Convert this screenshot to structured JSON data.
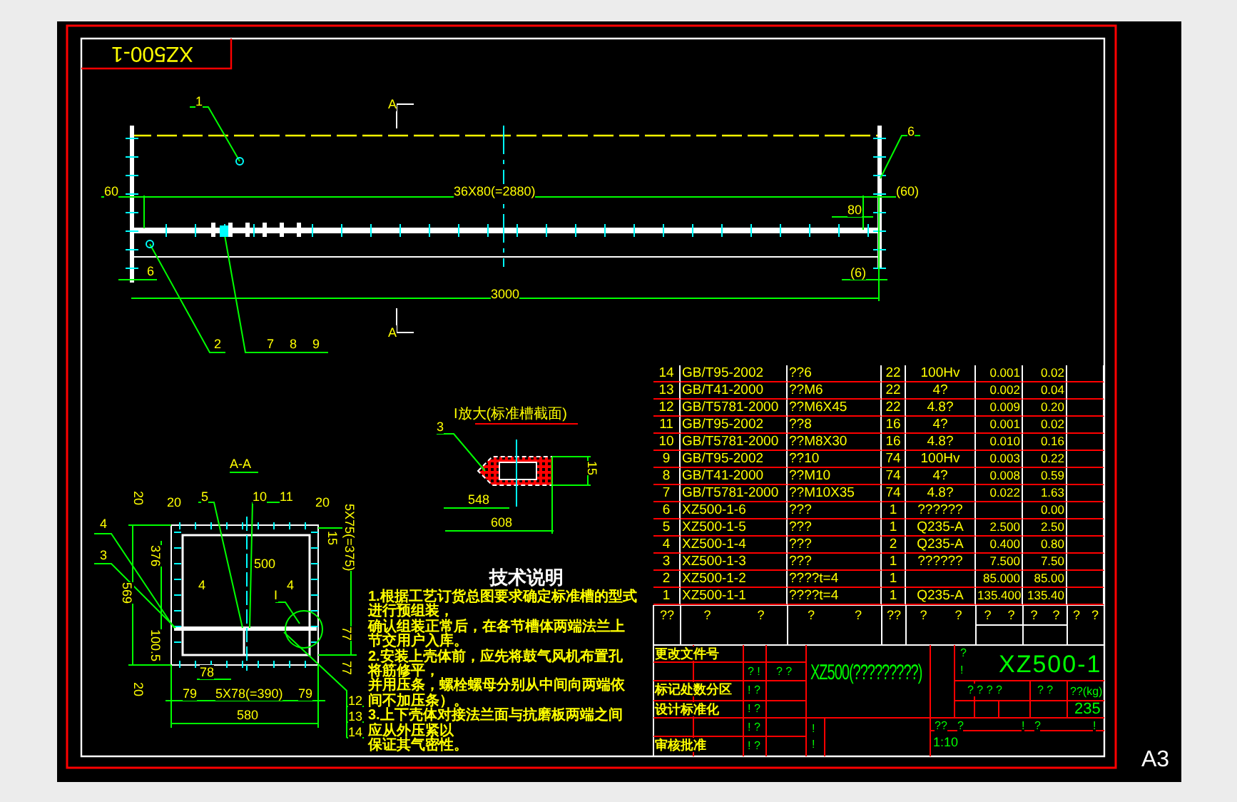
{
  "drawing_tab": "XZ500-1",
  "sheet_size": "A3",
  "main_view": {
    "labels": [
      "A",
      "1",
      "6",
      "60",
      "36X80(=2880)",
      "(60)",
      "80",
      "6",
      "(6)",
      "3000",
      "A",
      "2",
      "7",
      "8",
      "9"
    ]
  },
  "section_view": {
    "title": "A-A",
    "labels": [
      "20",
      "20",
      "5",
      "10",
      "11",
      "20",
      "4",
      "3",
      "376",
      "15",
      "5X75(=375)",
      "500",
      "569",
      "4",
      "4",
      "I",
      "77",
      "100.5",
      "77",
      "78",
      "20",
      "79",
      "5X78(=390)",
      "79",
      "580",
      "12",
      "13",
      "14"
    ]
  },
  "detail_view": {
    "title": "I放大(标准槽截面)",
    "labels": [
      "3",
      "15",
      "548",
      "608"
    ]
  },
  "notes": {
    "title": "技术说明",
    "lines": [
      "1.根据工艺订货总图要求确定标准槽的型式",
      "进行预组装，",
      "确认组装正常后，在各节槽体两端法兰上",
      "节交用户入库。",
      "2.安装上壳体前，应先将鼓气风机布置孔",
      "将筋修平，",
      "并用压条，螺栓螺母分别从中间向两端依",
      "间不加压条）。",
      "3.上下壳体对接法兰面与抗磨板两端之间",
      "应从外压紧以",
      "保证其气密性。"
    ]
  },
  "parts_list": {
    "rows": [
      {
        "no": "14",
        "code": "GB/T95-2002",
        "name": "??6",
        "qty": "22",
        "material": "100Hv",
        "unit_weight": "0.001",
        "total_weight": "0.02"
      },
      {
        "no": "13",
        "code": "GB/T41-2000",
        "name": "??M6",
        "qty": "22",
        "material": "4?",
        "unit_weight": "0.002",
        "total_weight": "0.04"
      },
      {
        "no": "12",
        "code": "GB/T5781-2000",
        "name": "??M6X45",
        "qty": "22",
        "material": "4.8?",
        "unit_weight": "0.009",
        "total_weight": "0.20"
      },
      {
        "no": "11",
        "code": "GB/T95-2002",
        "name": "??8",
        "qty": "16",
        "material": "4?",
        "unit_weight": "0.001",
        "total_weight": "0.02"
      },
      {
        "no": "10",
        "code": "GB/T5781-2000",
        "name": "??M8X30",
        "qty": "16",
        "material": "4.8?",
        "unit_weight": "0.010",
        "total_weight": "0.16"
      },
      {
        "no": "9",
        "code": "GB/T95-2002",
        "name": "??10",
        "qty": "74",
        "material": "100Hv",
        "unit_weight": "0.003",
        "total_weight": "0.22"
      },
      {
        "no": "8",
        "code": "GB/T41-2000",
        "name": "??M10",
        "qty": "74",
        "material": "4?",
        "unit_weight": "0.008",
        "total_weight": "0.59"
      },
      {
        "no": "7",
        "code": "GB/T5781-2000",
        "name": "??M10X35",
        "qty": "74",
        "material": "4.8?",
        "unit_weight": "0.022",
        "total_weight": "1.63"
      },
      {
        "no": "6",
        "code": "XZ500-1-6",
        "name": "???",
        "qty": "1",
        "material": "??????",
        "total_weight": "0.00"
      },
      {
        "no": "5",
        "code": "XZ500-1-5",
        "name": "???",
        "qty": "1",
        "material": "Q235-A",
        "unit_weight": "2.500",
        "total_weight": "2.50"
      },
      {
        "no": "4",
        "code": "XZ500-1-4",
        "name": "???",
        "qty": "2",
        "material": "Q235-A",
        "unit_weight": "0.400",
        "total_weight": "0.80"
      },
      {
        "no": "3",
        "code": "XZ500-1-3",
        "name": "???",
        "qty": "1",
        "material": "??????",
        "unit_weight": "7.500",
        "total_weight": "7.50"
      },
      {
        "no": "2",
        "code": "XZ500-1-2",
        "name": "????t=4",
        "qty": "1",
        "unit_weight": "85.000",
        "total_weight": "85.00"
      },
      {
        "no": "1",
        "code": "XZ500-1-1",
        "name": "????t=4",
        "qty": "1",
        "material": "Q235-A",
        "unit_weight": "135.400",
        "total_weight": "135.40"
      }
    ],
    "header": [
      [
        "??"
      ],
      [
        "?",
        "?"
      ],
      [
        "?",
        "?"
      ],
      [
        "??"
      ],
      [
        "?",
        "?"
      ],
      [
        "?",
        "?"
      ],
      [
        "?",
        "?"
      ],
      [
        "?",
        "?"
      ]
    ]
  },
  "title_block": {
    "project_name": "XZ500(?????????)",
    "drawing_number": "XZ500-1",
    "mass_label": "??(kg)",
    "mass": "235",
    "scale": "1:10",
    "marks": [
      "?",
      "!",
      "? ? ? ?",
      "? ?",
      "??",
      "?",
      "!",
      "?",
      "!",
      "? !",
      "? ?",
      "! ?",
      "! ?",
      "! ?",
      "! ?",
      "!",
      "!"
    ],
    "side_labels": [
      "更改文件号",
      "标记处数分区",
      "设计标准化",
      "审核批准"
    ]
  }
}
